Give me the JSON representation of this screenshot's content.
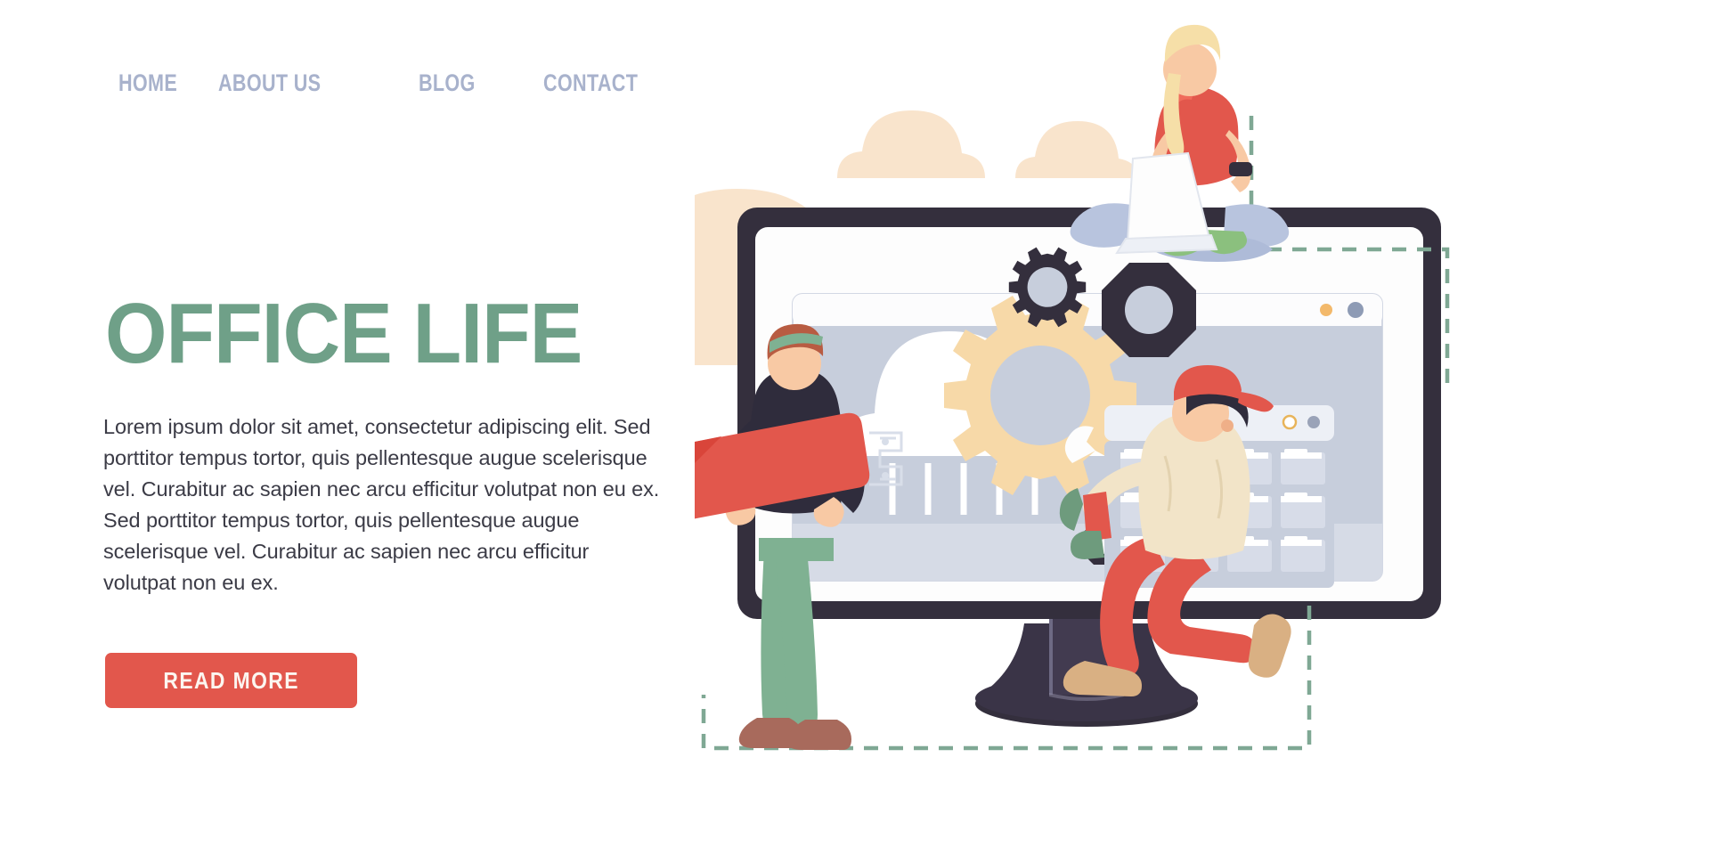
{
  "nav": {
    "items": [
      {
        "label": "HOME"
      },
      {
        "label": "ABOUT US"
      },
      {
        "label": "BLOG"
      },
      {
        "label": "CONTACT"
      }
    ]
  },
  "hero": {
    "headline": "OFFICE LIFE",
    "paragraph": "Lorem ipsum dolor sit amet, consectetur adipiscing elit. Sed porttitor tempus tortor, quis pellentesque augue scelerisque vel. Curabitur ac sapien nec arcu efficitur volutpat non eu ex. Sed porttitor tempus tortor, quis pellentesque augue scelerisque vel. Curabitur ac sapien nec arcu efficitur volutpat non eu ex.",
    "cta_label": "READ MORE"
  },
  "colors": {
    "nav_text": "#A8B2CC",
    "headline_green": "#6FA088",
    "body_text": "#3B3B46",
    "cta_background": "#E2574C",
    "cta_text": "#FCF6F0",
    "cloud_peach": "#F9E4CC",
    "monitor_bezel": "#342F3D",
    "screen_blue": "#C7CEDC",
    "gear_tan": "#F7D9A8",
    "dashed_green": "#7FA894",
    "accent_red": "#E2574C",
    "pants_green": "#7FB192",
    "jeans_blue": "#B8C4DE",
    "shirt_cream": "#F2E4C8",
    "boot_tan": "#D9B083",
    "hair_blonde": "#F6DFA8",
    "skin": "#F8C9A4"
  },
  "illustration": {
    "name": "office-life-illustration",
    "elements": [
      {
        "name": "background-cloud-large"
      },
      {
        "name": "background-cloud-small-left"
      },
      {
        "name": "background-cloud-small-right"
      },
      {
        "name": "desktop-monitor"
      },
      {
        "name": "monitor-screen-browser-window"
      },
      {
        "name": "screen-cloud-rain-graphic"
      },
      {
        "name": "large-tan-gear"
      },
      {
        "name": "dark-gear"
      },
      {
        "name": "dark-octagon-nut"
      },
      {
        "name": "small-dark-nut"
      },
      {
        "name": "file-manager-window"
      },
      {
        "name": "woman-with-laptop"
      },
      {
        "name": "man-carrying-wrench"
      },
      {
        "name": "kneeling-man-with-wrench"
      },
      {
        "name": "dashed-frame-decoration"
      }
    ]
  }
}
